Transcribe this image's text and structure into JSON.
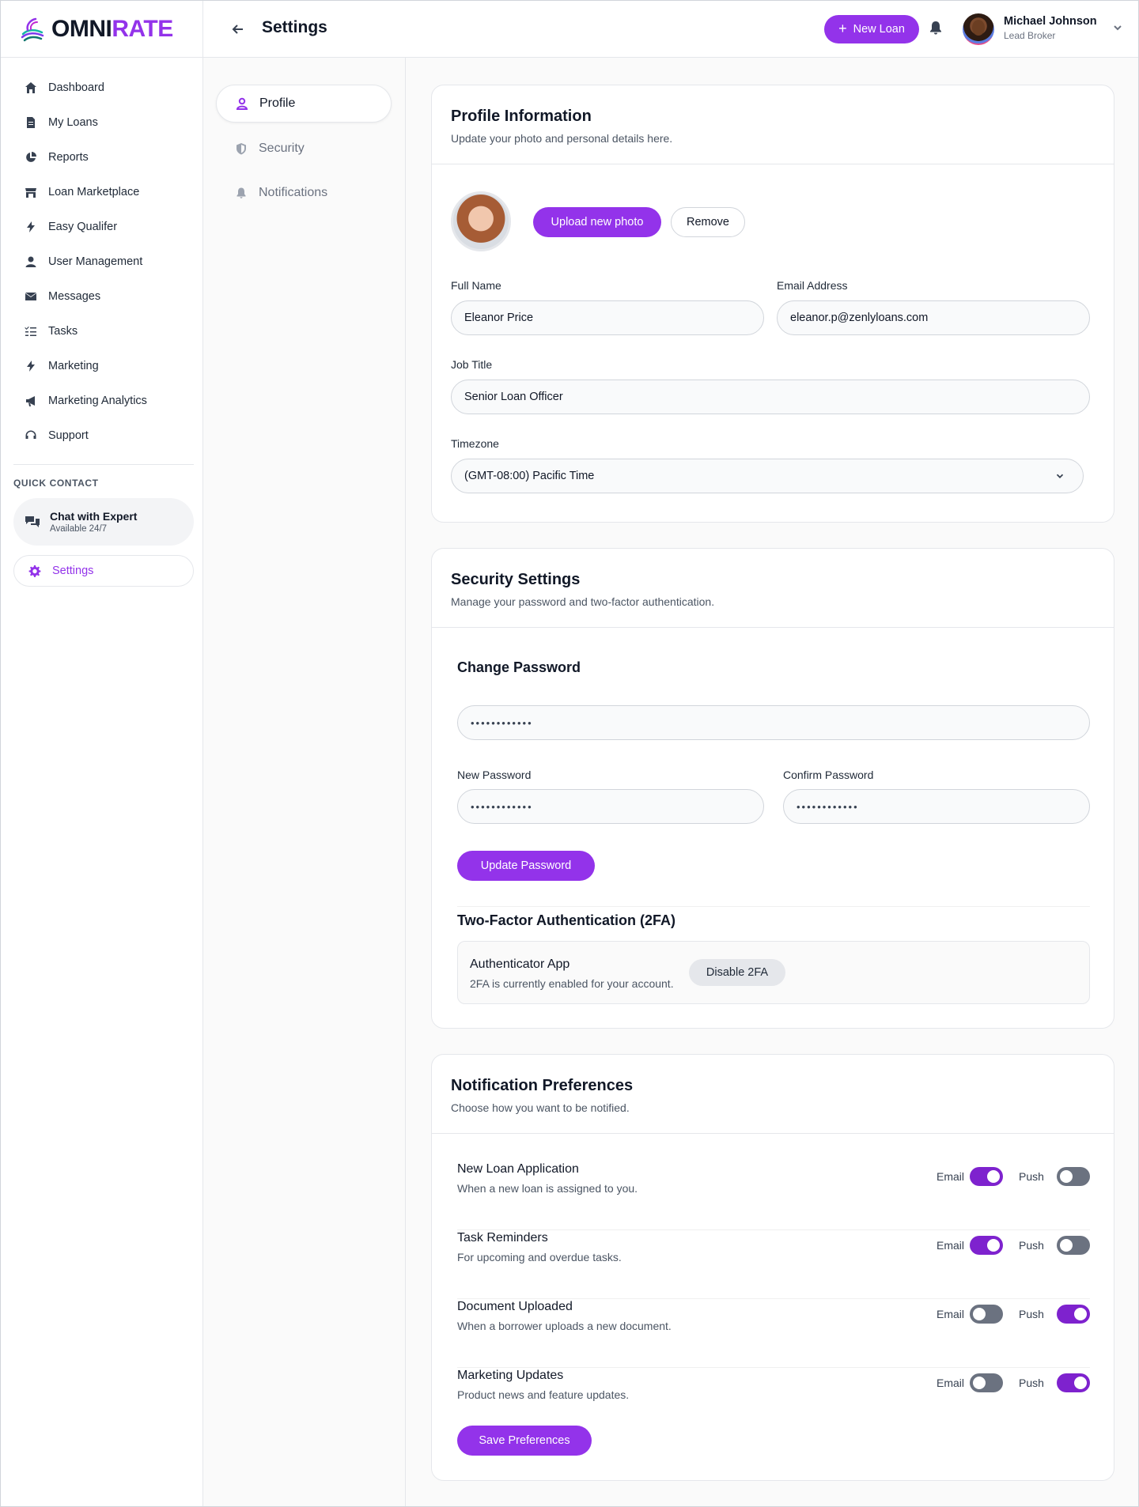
{
  "brand": {
    "part1": "OMNI",
    "part2": "RATE"
  },
  "sidebar": {
    "items": [
      {
        "label": "Dashboard",
        "icon": "home-icon"
      },
      {
        "label": "My Loans",
        "icon": "document-icon"
      },
      {
        "label": "Reports",
        "icon": "pie-chart-icon"
      },
      {
        "label": "Loan Marketplace",
        "icon": "store-icon"
      },
      {
        "label": "Easy Qualifer",
        "icon": "bolt-icon"
      },
      {
        "label": "User Management",
        "icon": "user-icon"
      },
      {
        "label": "Messages",
        "icon": "envelope-icon"
      },
      {
        "label": "Tasks",
        "icon": "checklist-icon"
      },
      {
        "label": "Marketing",
        "icon": "bolt-icon"
      },
      {
        "label": "Marketing Analytics",
        "icon": "megaphone-icon"
      },
      {
        "label": "Support",
        "icon": "headset-icon"
      }
    ],
    "quick_contact_label": "QUICK CONTACT",
    "chat": {
      "title": "Chat with Expert",
      "subtitle": "Available 24/7"
    },
    "settings_label": "Settings"
  },
  "header": {
    "title": "Settings",
    "new_loan_label": "New Loan",
    "user": {
      "name": "Michael Johnson",
      "role": "Lead Broker"
    }
  },
  "subnav": {
    "items": [
      "Profile",
      "Security",
      "Notifications"
    ],
    "active": "Profile"
  },
  "profile": {
    "title": "Profile Information",
    "subtitle": "Update your photo and personal details here.",
    "upload_label": "Upload new photo",
    "remove_label": "Remove",
    "full_name_label": "Full Name",
    "full_name_value": "Eleanor Price",
    "email_label": "Email Address",
    "email_value": "eleanor.p@zenlyloans.com",
    "job_label": "Job Title",
    "job_value": "Senior Loan Officer",
    "timezone_label": "Timezone",
    "timezone_value": "(GMT-08:00) Pacific Time"
  },
  "security": {
    "title": "Security Settings",
    "subtitle": "Manage your password and two-factor authentication.",
    "change_password_title": "Change Password",
    "current_password_value": "••••••••••••",
    "new_password_label": "New Password",
    "new_password_value": "••••••••••••",
    "confirm_password_label": "Confirm Password",
    "confirm_password_value": "••••••••••••",
    "update_label": "Update Password",
    "twofa_title": "Two-Factor Authentication (2FA)",
    "auth_app_title": "Authenticator App",
    "auth_app_desc": "2FA is currently enabled for your account.",
    "disable_label": "Disable 2FA"
  },
  "notifications": {
    "title": "Notification Preferences",
    "subtitle": "Choose how you want to be notified.",
    "email_label": "Email",
    "push_label": "Push",
    "rows": [
      {
        "title": "New Loan Application",
        "desc": "When a new loan is assigned to you.",
        "email": true,
        "push": false
      },
      {
        "title": "Task Reminders",
        "desc": "For upcoming and overdue tasks.",
        "email": true,
        "push": false
      },
      {
        "title": "Document Uploaded",
        "desc": "When a borrower uploads a new document.",
        "email": false,
        "push": true
      },
      {
        "title": "Marketing Updates",
        "desc": "Product news and feature updates.",
        "email": false,
        "push": true
      }
    ],
    "save_label": "Save Preferences"
  },
  "colors": {
    "accent": "#9333ea",
    "toggle_on": "#7e22ce",
    "toggle_off": "#6b7280"
  }
}
